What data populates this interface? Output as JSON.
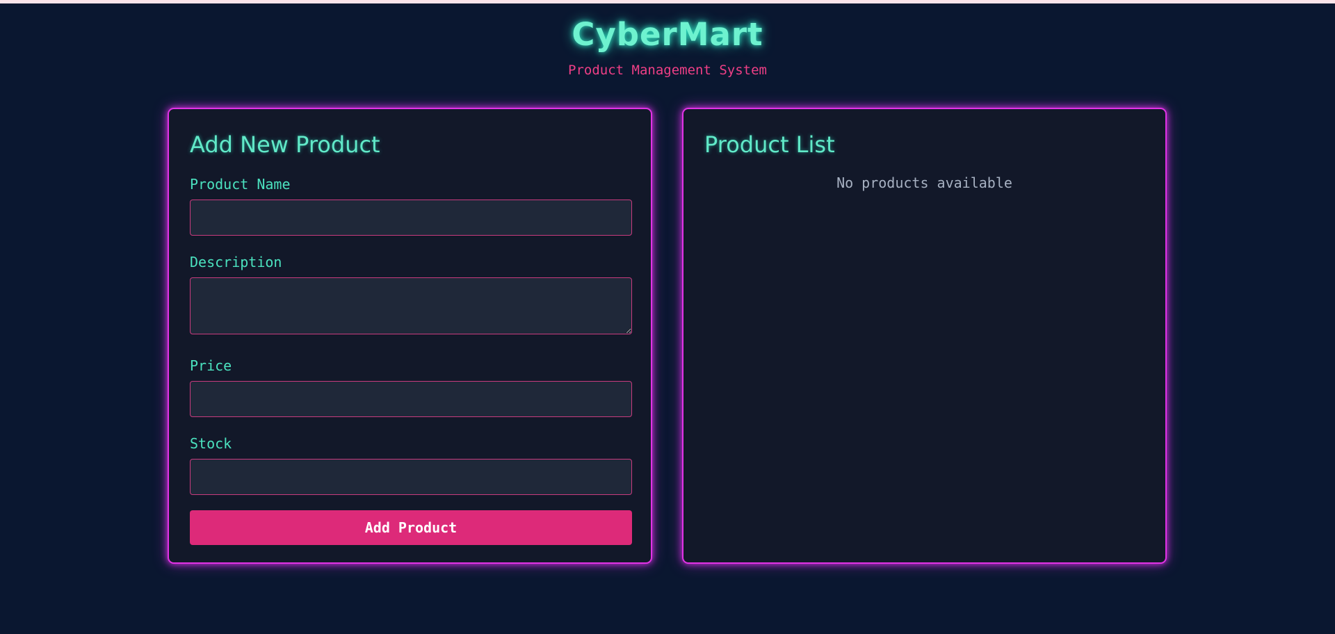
{
  "app": {
    "title": "CyberMart",
    "subtitle": "Product Management System"
  },
  "form": {
    "title": "Add New Product",
    "fields": {
      "name": {
        "label": "Product Name",
        "value": ""
      },
      "description": {
        "label": "Description",
        "value": ""
      },
      "price": {
        "label": "Price",
        "value": ""
      },
      "stock": {
        "label": "Stock",
        "value": ""
      }
    },
    "submit_label": "Add Product"
  },
  "product_list": {
    "title": "Product List",
    "empty_message": "No products available"
  },
  "colors": {
    "background": "#0a1730",
    "panel": "#121829",
    "neon_cyan": "#6ef2cf",
    "neon_magenta": "#e233e6",
    "accent_pink": "#dd2a79",
    "subtitle_pink": "#ef3f86"
  }
}
